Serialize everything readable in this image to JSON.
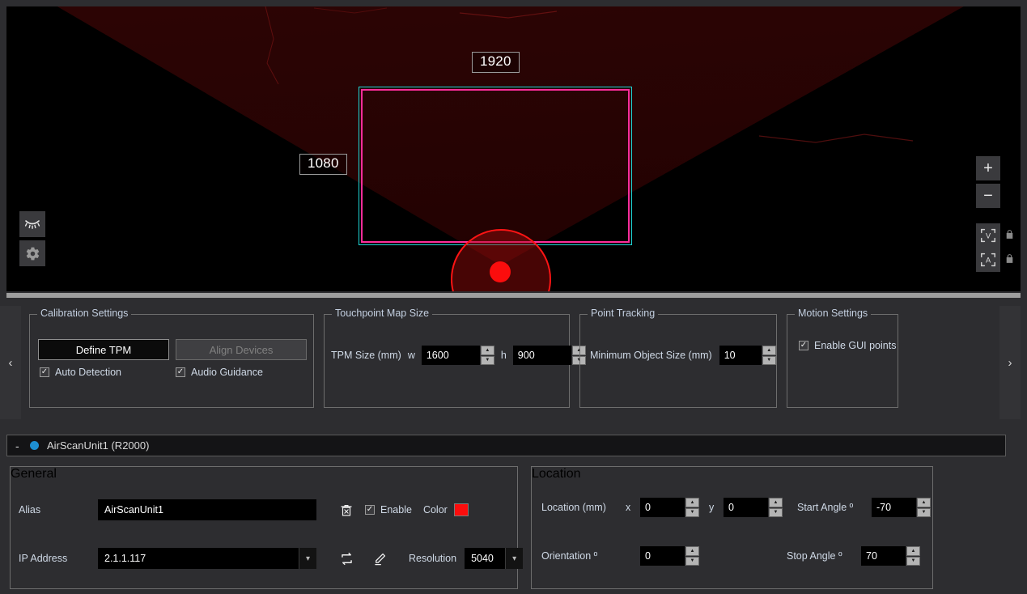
{
  "viewport": {
    "label_width": "1920",
    "label_height": "1080",
    "tools_left": [
      {
        "name": "visibility-icon",
        "label": "visibility"
      },
      {
        "name": "gear-icon",
        "label": "settings"
      }
    ],
    "zoom_in": "+",
    "zoom_out": "−",
    "fit_v_label": "V",
    "fit_a_label": "A",
    "colors": {
      "cone_fill": "#2a0303",
      "tpm_border": "#ff2d9b",
      "tpm_outline": "#1fd4d4",
      "sensor": "#fb0d0d",
      "background": "#000000"
    }
  },
  "settings": {
    "nav_prev": "‹",
    "nav_next": "›",
    "calibration": {
      "legend": "Calibration Settings",
      "define_tpm": "Define TPM",
      "align_devices": "Align Devices",
      "auto_detection": "Auto Detection",
      "audio_guidance": "Audio Guidance"
    },
    "touchpoint": {
      "legend": "Touchpoint Map Size",
      "label": "TPM Size (mm)",
      "w_label": "w",
      "w_value": "1600",
      "h_label": "h",
      "h_value": "900"
    },
    "point_tracking": {
      "legend": "Point Tracking",
      "min_obj_label": "Minimum Object Size (mm)",
      "min_obj_value": "10"
    },
    "motion": {
      "legend": "Motion Settings",
      "enable_gui_points": "Enable GUI points"
    }
  },
  "device": {
    "collapse_marker": "-",
    "title": "AirScanUnit1 (R2000)",
    "status_color": "#1e8fd1"
  },
  "general": {
    "legend": "General",
    "alias_label": "Alias",
    "alias_value": "AirScanUnit1",
    "ip_label": "IP Address",
    "ip_value": "2.1.1.117",
    "enable_label": "Enable",
    "color_label": "Color",
    "color_value": "#fc0d0d",
    "resolution_label": "Resolution",
    "resolution_value": "5040"
  },
  "location": {
    "legend": "Location",
    "location_label": "Location (mm)",
    "x_label": "x",
    "x_value": "0",
    "y_label": "y",
    "y_value": "0",
    "orientation_label": "Orientation º",
    "orientation_value": "0",
    "start_angle_label": "Start Angle º",
    "start_angle_value": "-70",
    "stop_angle_label": "Stop Angle  º",
    "stop_angle_value": "70"
  }
}
